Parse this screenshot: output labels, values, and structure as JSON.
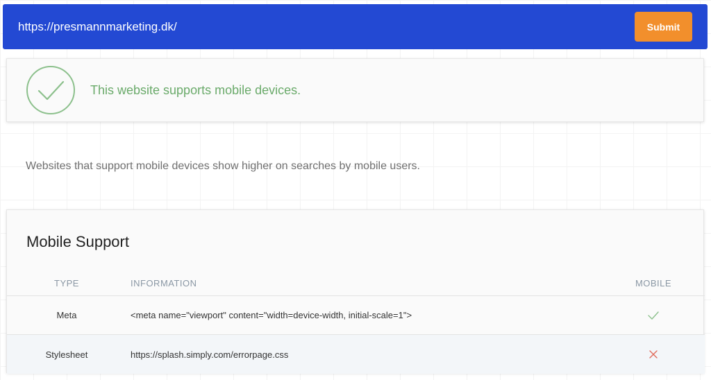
{
  "header": {
    "url_value": "https://presmannmarketing.dk/",
    "submit_label": "Submit",
    "colors": {
      "bar": "#2349d3",
      "submit": "#f28f2c"
    }
  },
  "status": {
    "message": "This website supports mobile devices.",
    "icon": "check-circle-icon",
    "color": "#6aaa6a"
  },
  "description": "Websites that support mobile devices show higher on searches by mobile users.",
  "support": {
    "title": "Mobile Support",
    "columns": {
      "type": "TYPE",
      "information": "INFORMATION",
      "mobile": "MOBILE"
    },
    "rows": [
      {
        "type": "Meta",
        "information": "<meta name=\"viewport\" content=\"width=device-width, initial-scale=1\">",
        "mobile": "check-icon",
        "mobile_color": "#8cc08c"
      },
      {
        "type": "Stylesheet",
        "information": "https://splash.simply.com/errorpage.css",
        "mobile": "cross-icon",
        "mobile_color": "#e06a5a"
      }
    ]
  }
}
